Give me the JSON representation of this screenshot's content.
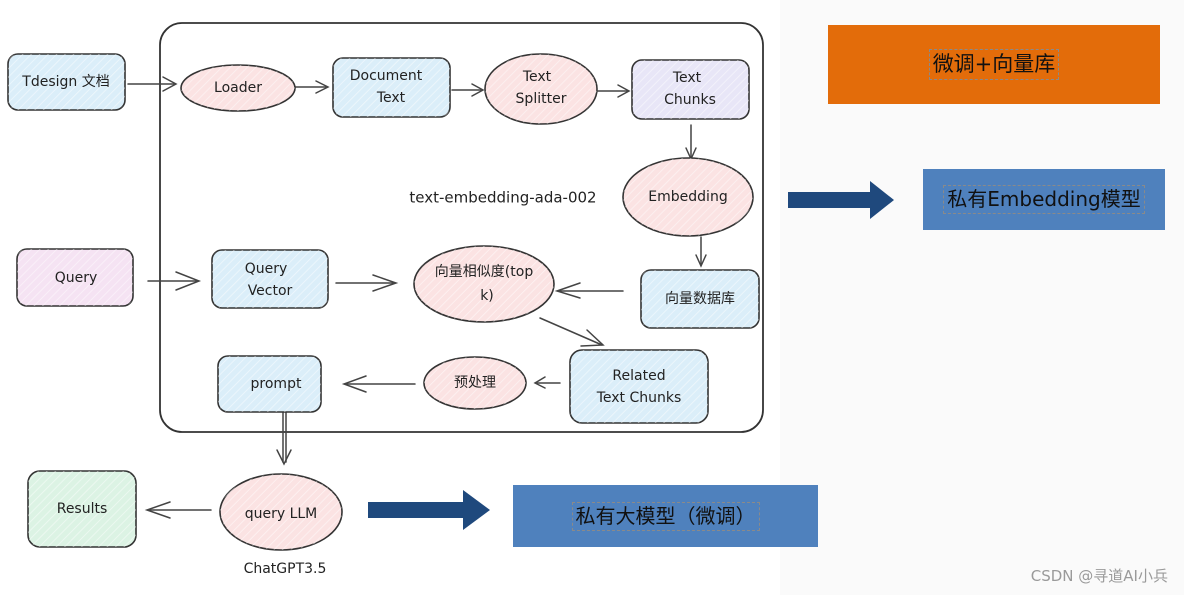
{
  "diagram": {
    "nodes": {
      "tdesign_doc": {
        "label": "Tdesign 文档",
        "shape": "rect",
        "fill": "#dbeef9"
      },
      "loader": {
        "label": "Loader",
        "shape": "ellipse",
        "fill": "#fbe3e3"
      },
      "document_text": {
        "line1": "Document",
        "line2": "Text",
        "shape": "rect",
        "fill": "#dbeef9"
      },
      "text_splitter": {
        "line1": "Text",
        "line2": "Splitter",
        "shape": "ellipse",
        "fill": "#fbe3e3"
      },
      "text_chunks": {
        "line1": "Text",
        "line2": "Chunks",
        "shape": "rect",
        "fill": "#e8e6f7"
      },
      "embedding": {
        "label": "Embedding",
        "shape": "ellipse",
        "fill": "#fbe3e3"
      },
      "embedding_model_note": {
        "label": "text-embedding-ada-002"
      },
      "query": {
        "label": "Query",
        "shape": "rect",
        "fill": "#f5e3f3"
      },
      "query_vector": {
        "line1": "Query",
        "line2": "Vector",
        "shape": "rect",
        "fill": "#dbeef9"
      },
      "similarity": {
        "line1": "向量相似度(top",
        "line2": "k)",
        "shape": "ellipse",
        "fill": "#fbe3e3"
      },
      "vector_db": {
        "label": "向量数据库",
        "shape": "rect",
        "fill": "#dbeef9"
      },
      "related_chunks": {
        "line1": "Related",
        "line2": "Text Chunks",
        "shape": "rect",
        "fill": "#dbeef9"
      },
      "preprocess": {
        "label": "预处理",
        "shape": "ellipse",
        "fill": "#fbe3e3"
      },
      "prompt": {
        "label": "prompt",
        "shape": "rect",
        "fill": "#dbeef9"
      },
      "query_llm": {
        "label": "query LLM",
        "shape": "ellipse",
        "fill": "#fbe3e3"
      },
      "llm_model_note": {
        "label": "ChatGPT3.5"
      },
      "results": {
        "label": "Results",
        "shape": "rect",
        "fill": "#dcf3e4"
      }
    },
    "edges": [
      {
        "from": "tdesign_doc",
        "to": "loader"
      },
      {
        "from": "loader",
        "to": "document_text"
      },
      {
        "from": "document_text",
        "to": "text_splitter"
      },
      {
        "from": "text_splitter",
        "to": "text_chunks"
      },
      {
        "from": "text_chunks",
        "to": "embedding"
      },
      {
        "from": "embedding",
        "to": "vector_db"
      },
      {
        "from": "query",
        "to": "query_vector"
      },
      {
        "from": "query_vector",
        "to": "similarity"
      },
      {
        "from": "vector_db",
        "to": "similarity"
      },
      {
        "from": "similarity",
        "to": "related_chunks"
      },
      {
        "from": "related_chunks",
        "to": "preprocess"
      },
      {
        "from": "preprocess",
        "to": "prompt"
      },
      {
        "from": "prompt",
        "to": "query_llm"
      },
      {
        "from": "query_llm",
        "to": "results"
      }
    ]
  },
  "callouts": {
    "finetune_vector": {
      "label": "微调+向量库",
      "color": "#e36c0a"
    },
    "private_embedding": {
      "label": "私有Embedding模型",
      "color": "#4f81bd"
    },
    "private_llm": {
      "label": "私有大模型（微调）",
      "color": "#4f81bd"
    },
    "arrow_color": "#1f497d"
  },
  "watermark": "CSDN @寻道AI小兵"
}
